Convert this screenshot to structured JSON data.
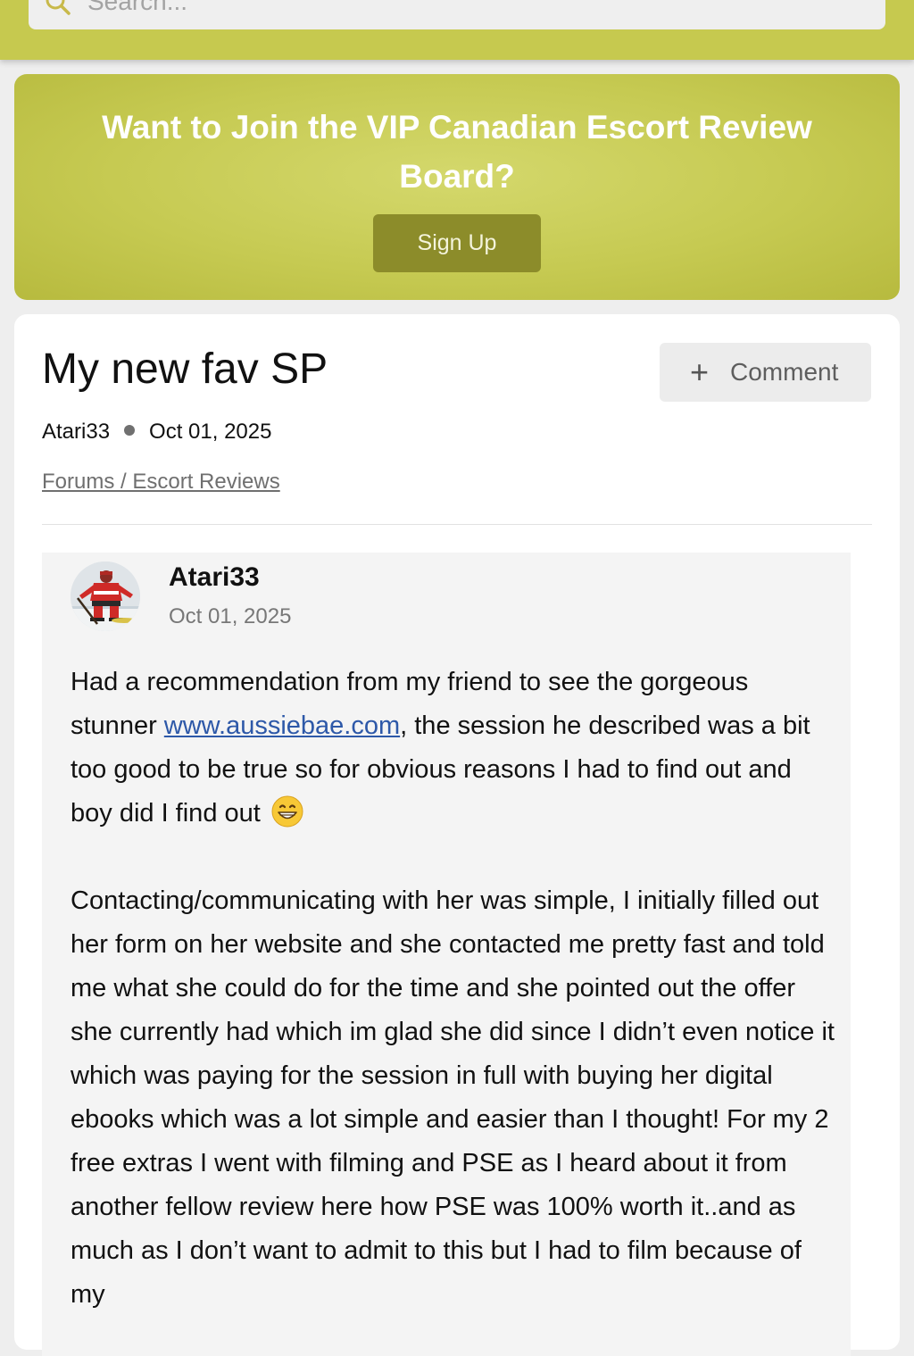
{
  "search": {
    "placeholder": "Search..."
  },
  "banner": {
    "title": "Want to Join the VIP Canadian Escort Review Board?",
    "signup_label": "Sign Up"
  },
  "thread": {
    "title": "My new fav SP",
    "comment_button_label": "Comment",
    "author": "Atari33",
    "date": "Oct 01, 2025",
    "breadcrumb": "Forums / Escort Reviews"
  },
  "post": {
    "author": "Atari33",
    "date": "Oct 01, 2025",
    "paragraph1_before_link": "Had a recommendation from my friend to see the gorgeous stunner ",
    "link_text": "www.aussiebae.com",
    "paragraph1_after_link": ", the session he described was a bit too good to be true so for obvious reasons I had to find out and boy did I find out ",
    "paragraph2": "Contacting/communicating with her was simple, I initially filled out her form on her website and she contacted me pretty fast and told me what she could do for the time and she pointed out the offer she currently had which im glad she did since I didn’t even notice it which was paying for the session in full with buying her digital ebooks which was a lot simple and easier than I thought! For my 2 free extras I went with filming and PSE as I heard about it from another fellow review here how PSE was 100% worth it..and as much as I don’t want to admit to this but I had to film because of my"
  },
  "colors": {
    "brand_olive": "#c6c94f",
    "button_olive": "#8c8c2a",
    "link_blue": "#2d58a8"
  },
  "icons": {
    "search": "search-icon",
    "plus": "plus-icon",
    "emoji": "grinning-face-emoji"
  }
}
